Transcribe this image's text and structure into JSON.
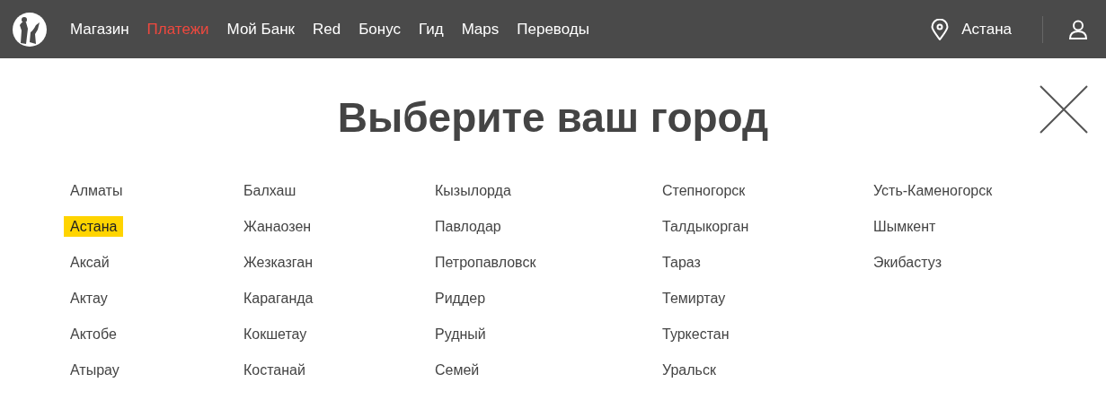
{
  "header": {
    "nav": [
      {
        "label": "Магазин",
        "selected": false
      },
      {
        "label": "Платежи",
        "selected": true
      },
      {
        "label": "Мой Банк",
        "selected": false
      },
      {
        "label": "Red",
        "selected": false
      },
      {
        "label": "Бонус",
        "selected": false
      },
      {
        "label": "Гид",
        "selected": false
      },
      {
        "label": "Maps",
        "selected": false
      },
      {
        "label": "Переводы",
        "selected": false
      }
    ],
    "city": "Астана"
  },
  "title": "Выберите ваш город",
  "columns": [
    [
      {
        "name": "Алматы",
        "selected": false
      },
      {
        "name": "Астана",
        "selected": true
      },
      {
        "name": "Аксай",
        "selected": false
      },
      {
        "name": "Актау",
        "selected": false
      },
      {
        "name": "Актобе",
        "selected": false
      },
      {
        "name": "Атырау",
        "selected": false
      }
    ],
    [
      {
        "name": "Балхаш",
        "selected": false
      },
      {
        "name": "Жанаозен",
        "selected": false
      },
      {
        "name": "Жезказган",
        "selected": false
      },
      {
        "name": "Караганда",
        "selected": false
      },
      {
        "name": "Кокшетау",
        "selected": false
      },
      {
        "name": "Костанай",
        "selected": false
      }
    ],
    [
      {
        "name": "Кызылорда",
        "selected": false
      },
      {
        "name": "Павлодар",
        "selected": false
      },
      {
        "name": "Петропавловск",
        "selected": false
      },
      {
        "name": "Риддер",
        "selected": false
      },
      {
        "name": "Рудный",
        "selected": false
      },
      {
        "name": "Семей",
        "selected": false
      }
    ],
    [
      {
        "name": "Степногорск",
        "selected": false
      },
      {
        "name": "Талдыкорган",
        "selected": false
      },
      {
        "name": "Тараз",
        "selected": false
      },
      {
        "name": "Темиртау",
        "selected": false
      },
      {
        "name": "Туркестан",
        "selected": false
      },
      {
        "name": "Уральск",
        "selected": false
      }
    ],
    [
      {
        "name": "Усть-Каменогорск",
        "selected": false
      },
      {
        "name": "Шымкент",
        "selected": false
      },
      {
        "name": "Экибастуз",
        "selected": false
      }
    ]
  ]
}
